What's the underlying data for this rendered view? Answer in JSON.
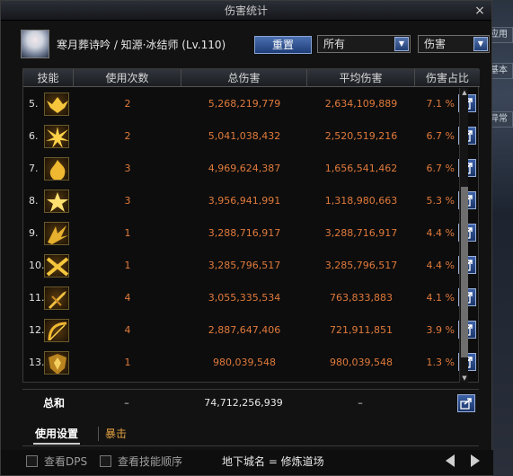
{
  "window": {
    "title": "伤害统计",
    "close": "×"
  },
  "header": {
    "character": "寒月葬诗吟 / 知源·冰结师 (Lv.110)",
    "reset_label": "重置",
    "filter_selected": "所有",
    "type_selected": "伤害"
  },
  "table": {
    "columns": [
      "技能",
      "使用次数",
      "总伤害",
      "平均伤害",
      "伤害占比"
    ],
    "rows": [
      {
        "rank": "5.",
        "uses": "2",
        "total": "5,268,219,779",
        "avg": "2,634,109,889",
        "share": "7.1 %",
        "icon": "skill-icon-wings"
      },
      {
        "rank": "6.",
        "uses": "2",
        "total": "5,041,038,432",
        "avg": "2,520,519,216",
        "share": "6.7 %",
        "icon": "skill-icon-burst"
      },
      {
        "rank": "7.",
        "uses": "3",
        "total": "4,969,624,387",
        "avg": "1,656,541,462",
        "share": "6.7 %",
        "icon": "skill-icon-flame"
      },
      {
        "rank": "8.",
        "uses": "3",
        "total": "3,956,941,991",
        "avg": "1,318,980,663",
        "share": "5.3 %",
        "icon": "skill-icon-star"
      },
      {
        "rank": "9.",
        "uses": "1",
        "total": "3,288,716,917",
        "avg": "3,288,716,917",
        "share": "4.4 %",
        "icon": "skill-icon-shards"
      },
      {
        "rank": "10.",
        "uses": "1",
        "total": "3,285,796,517",
        "avg": "3,285,796,517",
        "share": "4.4 %",
        "icon": "skill-icon-cross"
      },
      {
        "rank": "11.",
        "uses": "4",
        "total": "3,055,335,534",
        "avg": "763,833,883",
        "share": "4.1 %",
        "icon": "skill-icon-spear"
      },
      {
        "rank": "12.",
        "uses": "4",
        "total": "2,887,647,406",
        "avg": "721,911,851",
        "share": "3.9 %",
        "icon": "skill-icon-bow"
      },
      {
        "rank": "13.",
        "uses": "1",
        "total": "980,039,548",
        "avg": "980,039,548",
        "share": "1.3 %",
        "icon": "skill-icon-shield"
      }
    ],
    "total": {
      "label": "总和",
      "uses": "–",
      "total": "74,712,256,939",
      "avg": "–"
    }
  },
  "tabs": {
    "usage": "使用设置",
    "crit": "暴击"
  },
  "footer": {
    "view_dps": "查看DPS",
    "view_order": "查看技能顺序",
    "dungeon": "地下城名 = 修炼道场"
  },
  "side": {
    "tabs": [
      "应用",
      "基本",
      "异常"
    ]
  },
  "colors": {
    "accent_blue": "#2e529a",
    "value_orange": "#e07a3c"
  }
}
